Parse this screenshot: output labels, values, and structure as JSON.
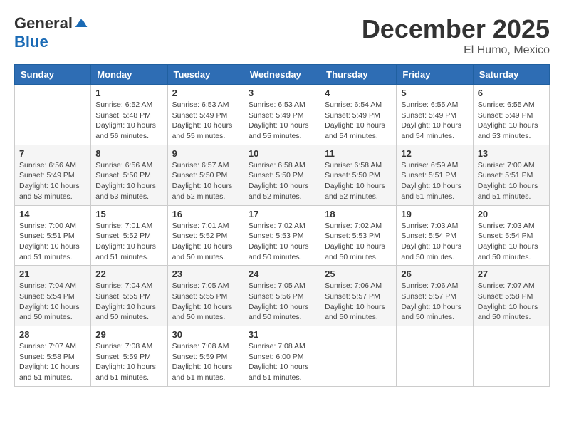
{
  "header": {
    "logo_general": "General",
    "logo_blue": "Blue",
    "month_title": "December 2025",
    "location": "El Humo, Mexico"
  },
  "days_of_week": [
    "Sunday",
    "Monday",
    "Tuesday",
    "Wednesday",
    "Thursday",
    "Friday",
    "Saturday"
  ],
  "weeks": [
    [
      {
        "day": "",
        "info": ""
      },
      {
        "day": "1",
        "info": "Sunrise: 6:52 AM\nSunset: 5:48 PM\nDaylight: 10 hours\nand 56 minutes."
      },
      {
        "day": "2",
        "info": "Sunrise: 6:53 AM\nSunset: 5:49 PM\nDaylight: 10 hours\nand 55 minutes."
      },
      {
        "day": "3",
        "info": "Sunrise: 6:53 AM\nSunset: 5:49 PM\nDaylight: 10 hours\nand 55 minutes."
      },
      {
        "day": "4",
        "info": "Sunrise: 6:54 AM\nSunset: 5:49 PM\nDaylight: 10 hours\nand 54 minutes."
      },
      {
        "day": "5",
        "info": "Sunrise: 6:55 AM\nSunset: 5:49 PM\nDaylight: 10 hours\nand 54 minutes."
      },
      {
        "day": "6",
        "info": "Sunrise: 6:55 AM\nSunset: 5:49 PM\nDaylight: 10 hours\nand 53 minutes."
      }
    ],
    [
      {
        "day": "7",
        "info": "Sunrise: 6:56 AM\nSunset: 5:49 PM\nDaylight: 10 hours\nand 53 minutes."
      },
      {
        "day": "8",
        "info": "Sunrise: 6:56 AM\nSunset: 5:50 PM\nDaylight: 10 hours\nand 53 minutes."
      },
      {
        "day": "9",
        "info": "Sunrise: 6:57 AM\nSunset: 5:50 PM\nDaylight: 10 hours\nand 52 minutes."
      },
      {
        "day": "10",
        "info": "Sunrise: 6:58 AM\nSunset: 5:50 PM\nDaylight: 10 hours\nand 52 minutes."
      },
      {
        "day": "11",
        "info": "Sunrise: 6:58 AM\nSunset: 5:50 PM\nDaylight: 10 hours\nand 52 minutes."
      },
      {
        "day": "12",
        "info": "Sunrise: 6:59 AM\nSunset: 5:51 PM\nDaylight: 10 hours\nand 51 minutes."
      },
      {
        "day": "13",
        "info": "Sunrise: 7:00 AM\nSunset: 5:51 PM\nDaylight: 10 hours\nand 51 minutes."
      }
    ],
    [
      {
        "day": "14",
        "info": "Sunrise: 7:00 AM\nSunset: 5:51 PM\nDaylight: 10 hours\nand 51 minutes."
      },
      {
        "day": "15",
        "info": "Sunrise: 7:01 AM\nSunset: 5:52 PM\nDaylight: 10 hours\nand 51 minutes."
      },
      {
        "day": "16",
        "info": "Sunrise: 7:01 AM\nSunset: 5:52 PM\nDaylight: 10 hours\nand 50 minutes."
      },
      {
        "day": "17",
        "info": "Sunrise: 7:02 AM\nSunset: 5:53 PM\nDaylight: 10 hours\nand 50 minutes."
      },
      {
        "day": "18",
        "info": "Sunrise: 7:02 AM\nSunset: 5:53 PM\nDaylight: 10 hours\nand 50 minutes."
      },
      {
        "day": "19",
        "info": "Sunrise: 7:03 AM\nSunset: 5:54 PM\nDaylight: 10 hours\nand 50 minutes."
      },
      {
        "day": "20",
        "info": "Sunrise: 7:03 AM\nSunset: 5:54 PM\nDaylight: 10 hours\nand 50 minutes."
      }
    ],
    [
      {
        "day": "21",
        "info": "Sunrise: 7:04 AM\nSunset: 5:54 PM\nDaylight: 10 hours\nand 50 minutes."
      },
      {
        "day": "22",
        "info": "Sunrise: 7:04 AM\nSunset: 5:55 PM\nDaylight: 10 hours\nand 50 minutes."
      },
      {
        "day": "23",
        "info": "Sunrise: 7:05 AM\nSunset: 5:55 PM\nDaylight: 10 hours\nand 50 minutes."
      },
      {
        "day": "24",
        "info": "Sunrise: 7:05 AM\nSunset: 5:56 PM\nDaylight: 10 hours\nand 50 minutes."
      },
      {
        "day": "25",
        "info": "Sunrise: 7:06 AM\nSunset: 5:57 PM\nDaylight: 10 hours\nand 50 minutes."
      },
      {
        "day": "26",
        "info": "Sunrise: 7:06 AM\nSunset: 5:57 PM\nDaylight: 10 hours\nand 50 minutes."
      },
      {
        "day": "27",
        "info": "Sunrise: 7:07 AM\nSunset: 5:58 PM\nDaylight: 10 hours\nand 50 minutes."
      }
    ],
    [
      {
        "day": "28",
        "info": "Sunrise: 7:07 AM\nSunset: 5:58 PM\nDaylight: 10 hours\nand 51 minutes."
      },
      {
        "day": "29",
        "info": "Sunrise: 7:08 AM\nSunset: 5:59 PM\nDaylight: 10 hours\nand 51 minutes."
      },
      {
        "day": "30",
        "info": "Sunrise: 7:08 AM\nSunset: 5:59 PM\nDaylight: 10 hours\nand 51 minutes."
      },
      {
        "day": "31",
        "info": "Sunrise: 7:08 AM\nSunset: 6:00 PM\nDaylight: 10 hours\nand 51 minutes."
      },
      {
        "day": "",
        "info": ""
      },
      {
        "day": "",
        "info": ""
      },
      {
        "day": "",
        "info": ""
      }
    ]
  ]
}
